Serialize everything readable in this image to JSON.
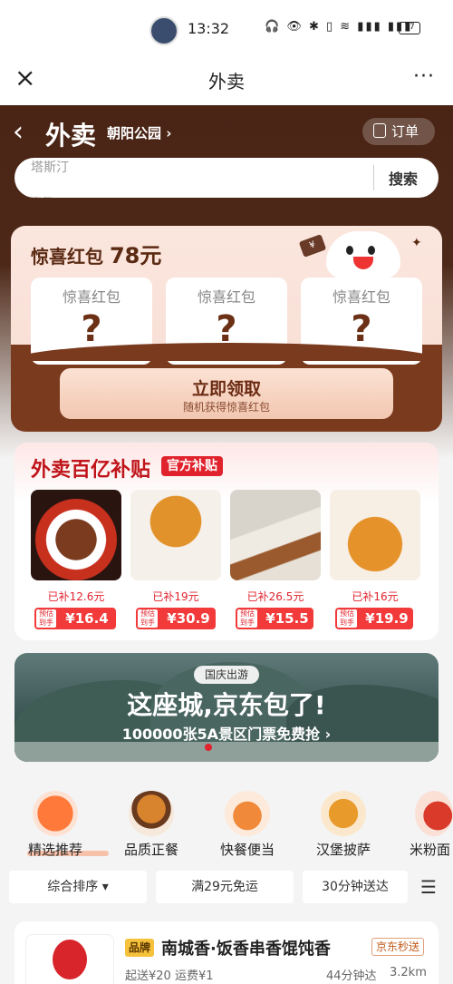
{
  "status_bar": {
    "time": "13:32",
    "icons": "🎧 👁 ✱ ▯ ≋ ▮▮▮ ▮▮▮",
    "battery": "77"
  },
  "title_bar": {
    "title": "外卖",
    "close_icon": "×",
    "more_icon": "···"
  },
  "hero": {
    "back": "‹",
    "title": "外卖",
    "location": "朝阳公园 ›",
    "order_label": "订单"
  },
  "search": {
    "placeholder": "塔斯汀",
    "placeholder_next": "麦但",
    "button": "搜索"
  },
  "red_packet": {
    "title": "惊喜红包",
    "amount": "78元",
    "slots": [
      {
        "label": "惊喜红包",
        "mark": "?"
      },
      {
        "label": "惊喜红包",
        "mark": "?"
      },
      {
        "label": "惊喜红包",
        "mark": "?"
      }
    ],
    "button_main": "立即领取",
    "button_sub": "随机获得惊喜红包",
    "ticket_symbol": "¥",
    "star": "✦"
  },
  "subsidy": {
    "title": "外卖百亿补贴",
    "badge": "官方补贴",
    "items": [
      {
        "subsidy": "已补12.6元",
        "tag": "预估到手",
        "price": "¥16.4",
        "color": "#8b2a1a"
      },
      {
        "subsidy": "已补19元",
        "tag": "预估到手",
        "price": "¥30.9",
        "color": "#d9801f"
      },
      {
        "subsidy": "已补26.5元",
        "tag": "预估到手",
        "price": "¥15.5",
        "color": "#9a5a2e"
      },
      {
        "subsidy": "已补16元",
        "tag": "预估到手",
        "price": "¥19.9",
        "color": "#e0901e"
      }
    ]
  },
  "banner": {
    "tag": "国庆出游",
    "line1": "这座城,京东包了!",
    "line2": "100000张5A景区门票免费抢 ›"
  },
  "categories": [
    {
      "label": "精选推荐",
      "color": "#e8451e"
    },
    {
      "label": "品质正餐",
      "color": "#d8832e"
    },
    {
      "label": "快餐便当",
      "color": "#e66a2a"
    },
    {
      "label": "汉堡披萨",
      "color": "#e89a2a"
    },
    {
      "label": "米粉面",
      "color": "#d93a2a"
    }
  ],
  "filters": {
    "sort": "综合排序 ▾",
    "free_delivery": "满29元免运",
    "fast": "30分钟送达",
    "menu_icon": "☰"
  },
  "store": {
    "brand_tag": "品牌",
    "name": "南城香·饭香串香馄饨香",
    "jd_tag": "京东秒送",
    "meta": "起送¥20  运费¥1",
    "time": "44分钟达",
    "distance": "3.2km"
  }
}
